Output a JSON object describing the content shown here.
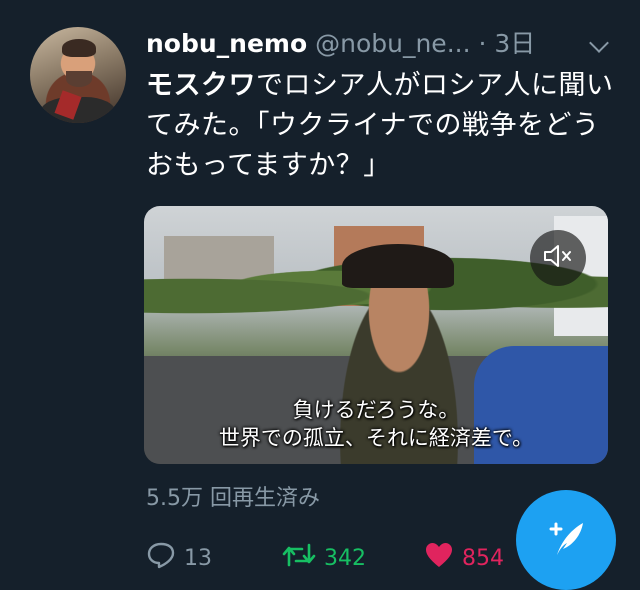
{
  "tweet": {
    "author_name": "nobu_nemo",
    "author_handle": "@nobu_ne...",
    "separator": "·",
    "time": "3日",
    "text_bold": "モスクワ",
    "text_rest": "でロシア人がロシア人に聞いてみた。「ウクライナでの戦争をどうおもってますか？」"
  },
  "video": {
    "caption_line1": "負けるだろうな。",
    "caption_line2": "世界での孤立、それに経済差で。",
    "mute_icon": "speaker-muted-icon"
  },
  "stats": {
    "views": "5.5万 回再生済み"
  },
  "actions": {
    "reply_count": "13",
    "retweet_count": "342",
    "like_count": "854"
  },
  "colors": {
    "background": "#15202b",
    "muted_text": "#8899a6",
    "retweet": "#17bf63",
    "like": "#e0245e",
    "accent": "#1da1f2"
  }
}
